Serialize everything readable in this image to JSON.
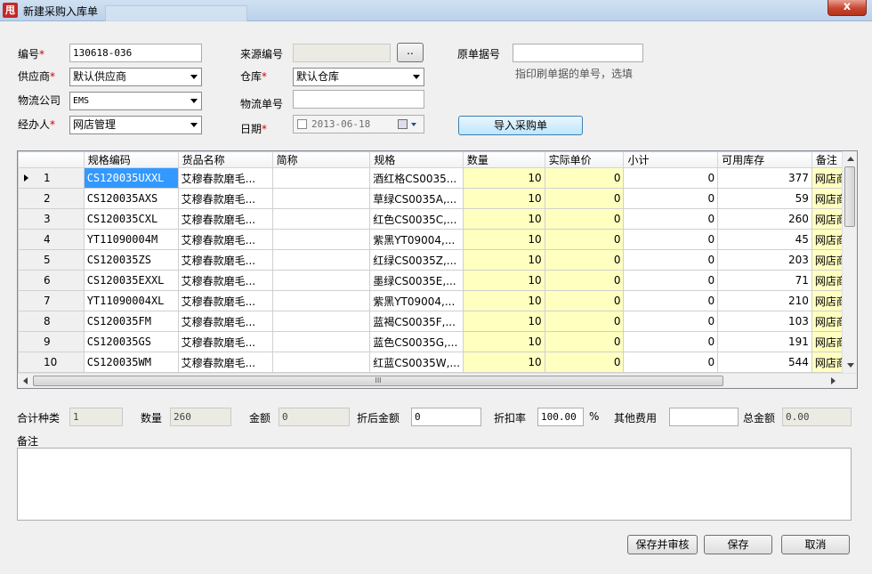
{
  "window": {
    "title": "新建采购入库单",
    "icon_text": "甩",
    "close_label": "x"
  },
  "form": {
    "bill_no": {
      "label": "编号",
      "value": "130618-036"
    },
    "supplier": {
      "label": "供应商",
      "value": "默认供应商"
    },
    "logistics_company": {
      "label": "物流公司",
      "value": "EMS"
    },
    "handler": {
      "label": "经办人",
      "value": "网店管理"
    },
    "source_no": {
      "label": "来源编号",
      "value": "",
      "browse_label": ".."
    },
    "warehouse": {
      "label": "仓库",
      "value": "默认仓库"
    },
    "logistics_no": {
      "label": "物流单号",
      "value": ""
    },
    "date": {
      "label": "日期",
      "value": "2013-06-18"
    },
    "original_no": {
      "label": "原单据号",
      "value": "",
      "hint": "指印刷单据的单号，选填"
    },
    "import_button": "导入采购单"
  },
  "grid": {
    "columns": [
      "规格编码",
      "货品名称",
      "简称",
      "规格",
      "数量",
      "实际单价",
      "小计",
      "可用库存",
      "备注"
    ],
    "rows": [
      {
        "n": "1",
        "code": "CS120035UXXL",
        "name": "艾穆春款磨毛...",
        "short": "",
        "spec": "酒红格CS0035...",
        "qty": "10",
        "price": "0",
        "subtotal": "0",
        "stock": "377",
        "remark": "网店商"
      },
      {
        "n": "2",
        "code": "CS120035AXS",
        "name": "艾穆春款磨毛...",
        "short": "",
        "spec": "草绿CS0035A,...",
        "qty": "10",
        "price": "0",
        "subtotal": "0",
        "stock": "59",
        "remark": "网店商"
      },
      {
        "n": "3",
        "code": "CS120035CXL",
        "name": "艾穆春款磨毛...",
        "short": "",
        "spec": "红色CS0035C,...",
        "qty": "10",
        "price": "0",
        "subtotal": "0",
        "stock": "260",
        "remark": "网店商"
      },
      {
        "n": "4",
        "code": "YT11090004M",
        "name": "艾穆春款磨毛...",
        "short": "",
        "spec": "紫黑YT09004,...",
        "qty": "10",
        "price": "0",
        "subtotal": "0",
        "stock": "45",
        "remark": "网店商"
      },
      {
        "n": "5",
        "code": "CS120035ZS",
        "name": "艾穆春款磨毛...",
        "short": "",
        "spec": "红绿CS0035Z,...",
        "qty": "10",
        "price": "0",
        "subtotal": "0",
        "stock": "203",
        "remark": "网店商"
      },
      {
        "n": "6",
        "code": "CS120035EXXL",
        "name": "艾穆春款磨毛...",
        "short": "",
        "spec": "墨绿CS0035E,...",
        "qty": "10",
        "price": "0",
        "subtotal": "0",
        "stock": "71",
        "remark": "网店商"
      },
      {
        "n": "7",
        "code": "YT11090004XL",
        "name": "艾穆春款磨毛...",
        "short": "",
        "spec": "紫黑YT09004,...",
        "qty": "10",
        "price": "0",
        "subtotal": "0",
        "stock": "210",
        "remark": "网店商"
      },
      {
        "n": "8",
        "code": "CS120035FM",
        "name": "艾穆春款磨毛...",
        "short": "",
        "spec": "蓝褐CS0035F,...",
        "qty": "10",
        "price": "0",
        "subtotal": "0",
        "stock": "103",
        "remark": "网店商"
      },
      {
        "n": "9",
        "code": "CS120035GS",
        "name": "艾穆春款磨毛...",
        "short": "",
        "spec": "蓝色CS0035G,...",
        "qty": "10",
        "price": "0",
        "subtotal": "0",
        "stock": "191",
        "remark": "网店商"
      },
      {
        "n": "10",
        "code": "CS120035WM",
        "name": "艾穆春款磨毛...",
        "short": "",
        "spec": "红蓝CS0035W,...",
        "qty": "10",
        "price": "0",
        "subtotal": "0",
        "stock": "544",
        "remark": "网店商"
      }
    ],
    "hscroll_grip": "III"
  },
  "summary": {
    "kinds": {
      "label": "合计种类",
      "value": "1"
    },
    "qty": {
      "label": "数量",
      "value": "260"
    },
    "amount": {
      "label": "金额",
      "value": "0"
    },
    "discounted": {
      "label": "折后金额",
      "value": "0"
    },
    "discount_rate": {
      "label": "折扣率",
      "value": "100.00",
      "unit": "%"
    },
    "other_fee": {
      "label": "其他费用",
      "value": ""
    },
    "total": {
      "label": "总金额",
      "value": "0.00"
    }
  },
  "remarks": {
    "label": "备注",
    "value": ""
  },
  "buttons": {
    "save_audit": "保存并审核",
    "save": "保存",
    "cancel": "取消"
  },
  "colors": {
    "accent": "#3399ff",
    "editable_cell": "#ffffc0",
    "required": "#d00000"
  }
}
